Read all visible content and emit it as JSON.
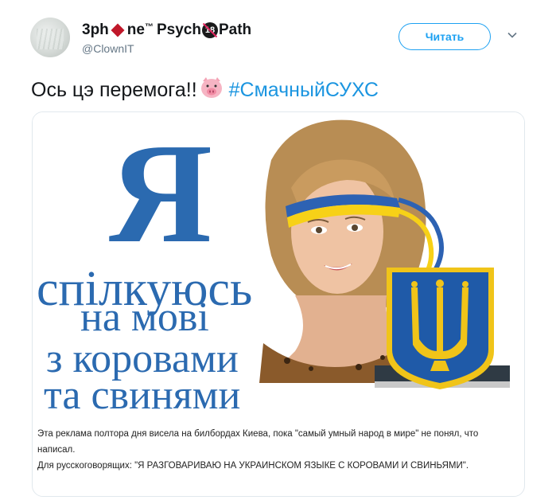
{
  "author": {
    "name_part1": "3ph",
    "name_part2": "ne",
    "tm": "™",
    "name_part3": "Psych",
    "badge": "18",
    "name_part4": "Path",
    "handle": "@ClownIT"
  },
  "follow_button": {
    "label": "Читать"
  },
  "tweet": {
    "text": "Ось цэ перемога!!",
    "hashtag": "#СмачныйСУХС"
  },
  "poster": {
    "big_letter": "Я",
    "lines": [
      "спілкуюсь",
      "на мові",
      "з коровами",
      "та свинями"
    ]
  },
  "caption": {
    "line1": "Эта реклама полтора дня висела на билбордах Киева, пока \"самый умный народ в мире\" не понял, что написал.",
    "line2": "Для русскоговорящих: \"Я РАЗГОВАРИВАЮ НА УКРАИНСКОМ ЯЗЫКЕ С КОРОВАМИ И СВИНЬЯМИ\"."
  },
  "colors": {
    "accent": "#1da1f2",
    "hashtag": "#1b95e0",
    "poster_blue": "#2b6ab0",
    "flag_yellow": "#f7d117"
  },
  "icons": {
    "diamond": "red-diamond-icon",
    "no18": "no-under-18-icon",
    "pig": "pig-face-emoji",
    "chevron": "chevron-down-icon"
  }
}
